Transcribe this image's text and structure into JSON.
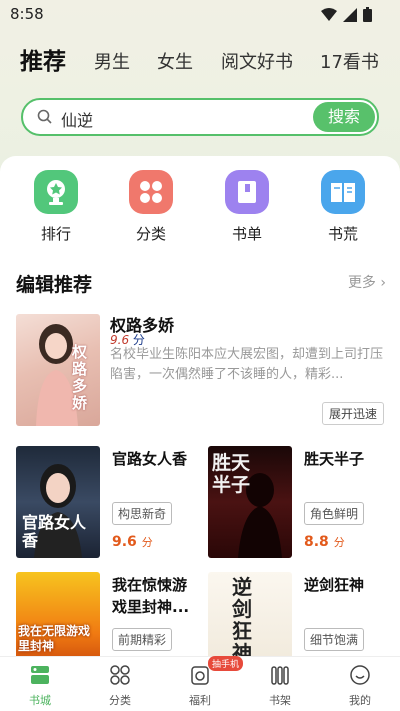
{
  "status_bar": {
    "time": "8:58"
  },
  "tabs": [
    {
      "label": "推荐",
      "active": true
    },
    {
      "label": "男生"
    },
    {
      "label": "女生"
    },
    {
      "label": "阅文好书"
    },
    {
      "label": "17看书"
    }
  ],
  "search": {
    "value": "仙逆",
    "button_label": "搜索"
  },
  "categories": [
    {
      "label": "排行",
      "icon": "trophy-icon",
      "color": "#52c77b"
    },
    {
      "label": "分类",
      "icon": "grid-icon",
      "color": "#f0786c"
    },
    {
      "label": "书单",
      "icon": "booklist-icon",
      "color": "#9d82ef"
    },
    {
      "label": "书荒",
      "icon": "book-icon",
      "color": "#4aa6ec"
    }
  ],
  "section": {
    "title": "编辑推荐",
    "more_label": "更多"
  },
  "featured": {
    "title": "权路多娇",
    "score": "9.6",
    "score_unit": "分",
    "description": "名校毕业生陈阳本应大展宏图，却遭到上司打压陷害，一次偶然睡了不该睡的人，精彩...",
    "tag": "展开迅速",
    "cover_text": "权路多娇"
  },
  "books": [
    {
      "title": "官路女人香",
      "tag": "构思新奇",
      "score": "9.6",
      "score_unit": "分",
      "cover_text": "官路女人香"
    },
    {
      "title": "胜天半子",
      "tag": "角色鲜明",
      "score": "8.8",
      "score_unit": "分",
      "cover_text": "胜天半子"
    },
    {
      "title": "我在惊悚游戏里封神...",
      "tag": "前期精彩",
      "cover_text": "我在无限游戏里封神"
    },
    {
      "title": "逆剑狂神",
      "tag": "细节饱满",
      "cover_text": "逆剑狂神"
    }
  ],
  "bottom_nav": [
    {
      "label": "书城",
      "icon": "bookstore-icon",
      "active": true
    },
    {
      "label": "分类",
      "icon": "category-icon"
    },
    {
      "label": "福利",
      "icon": "gift-icon",
      "badge": "抽手机"
    },
    {
      "label": "书架",
      "icon": "bookshelf-icon"
    },
    {
      "label": "我的",
      "icon": "profile-icon"
    }
  ],
  "colors": {
    "accent": "#58c16b",
    "score": "#e25a1c"
  }
}
